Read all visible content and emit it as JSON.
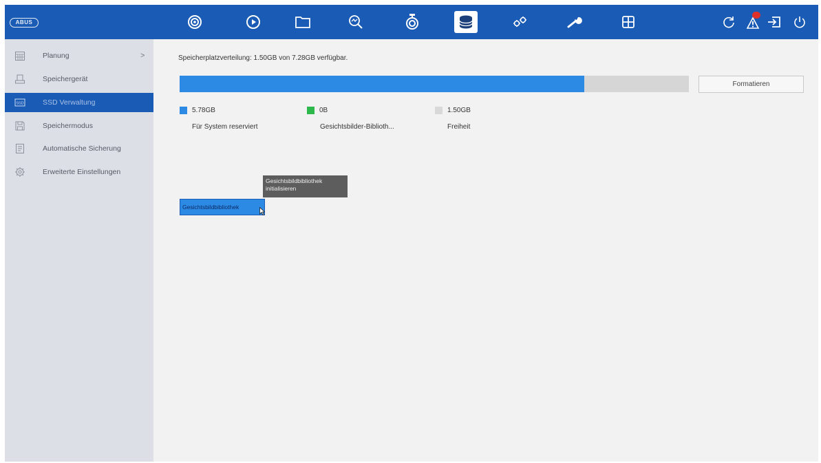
{
  "app": {
    "logo_text": "ABUS"
  },
  "topbar": {
    "nav_icons": [
      "live-view-icon",
      "playback-icon",
      "file-management-icon",
      "search-icon",
      "ptz-camera-icon",
      "storage-icon",
      "configuration-icon",
      "maintenance-icon",
      "layout-icon"
    ],
    "active_nav": "storage-icon",
    "right_icons": [
      "refresh-icon",
      "alarm-icon",
      "logout-icon",
      "power-icon"
    ],
    "alarm_badge": ""
  },
  "sidebar": {
    "items": [
      {
        "label": "Planung",
        "icon": "calendar-icon",
        "has_submenu": true,
        "active": false
      },
      {
        "label": "Speichergerät",
        "icon": "storage-device-icon",
        "active": false
      },
      {
        "label": "SSD Verwaltung",
        "icon": "ssd-icon",
        "active": true
      },
      {
        "label": "Speichermodus",
        "icon": "storage-mode-icon",
        "active": false
      },
      {
        "label": "Automatische Sicherung",
        "icon": "backup-icon",
        "active": false
      },
      {
        "label": "Erweiterte Einstellungen",
        "icon": "advanced-settings-icon",
        "active": false
      }
    ],
    "submenu_chevron": ">"
  },
  "main": {
    "allocation_text": "Speicherplatzverteilung: 1.50GB von 7.28GB verfügbar.",
    "usage_fraction": 0.794,
    "format_button": "Formatieren",
    "legend": [
      {
        "value": "5.78GB",
        "label": "Für System reserviert",
        "color": "#2d8ae4"
      },
      {
        "value": "0B",
        "label": "Gesichtsbilder-Biblioth...",
        "color": "#2db84b"
      },
      {
        "value": "1.50GB",
        "label": "Freiheit",
        "color": "#d9d9d9"
      }
    ],
    "tooltip": "Gesichtsbildbibliothek initialisieren",
    "face_library_button": "Gesichtsbildbibliothek"
  },
  "colors": {
    "topbar": "#1a5bb5",
    "accent": "#2d8ae4",
    "sidebar": "#dcdfe5",
    "background": "#f2f2f2"
  }
}
